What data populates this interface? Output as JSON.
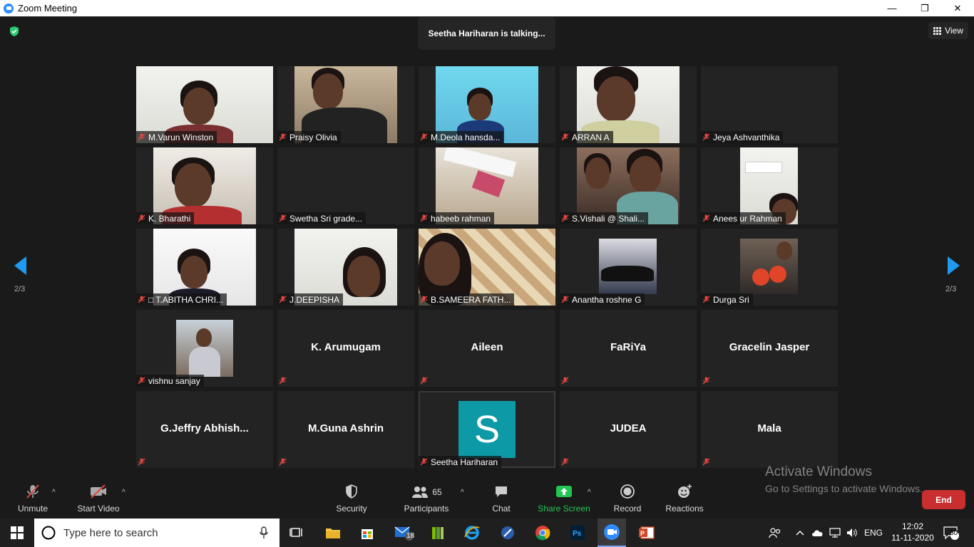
{
  "window": {
    "title": "Zoom Meeting",
    "minimize": "—",
    "restore": "❐",
    "close": "✕"
  },
  "banner": {
    "talking": "Seetha Hariharan is talking..."
  },
  "view": {
    "label": "View"
  },
  "pager": {
    "left": "2/3",
    "right": "2/3"
  },
  "participants_tiles": [
    "M.Varun Winston",
    "Praisy Olivia",
    "M.Deola hansda...",
    "ARRAN A",
    "Jeya Ashvanthika",
    "K. Bharathi",
    "Swetha Sri grade...",
    "habeeb rahman",
    "S.Vishali @ Shali...",
    "Anees ur Rahman",
    "□ T.ABITHA CHRI...",
    "J.DEEPISHA",
    "B.SAMEERA FATH...",
    "Anantha roshne G",
    "Durga Sri",
    "vishnu sanjay",
    "K. Arumugam",
    "Aileen",
    "FaRiYa",
    "Gracelin Jasper",
    "G.Jeffry Abhish...",
    "M.Guna Ashrin",
    "Seetha Hariharan",
    "JUDEA",
    "Mala"
  ],
  "avatar_letter": "S",
  "toolbar": {
    "unmute": "Unmute",
    "start_video": "Start Video",
    "security": "Security",
    "participants": "Participants",
    "participants_count": "65",
    "chat": "Chat",
    "share_screen": "Share Screen",
    "record": "Record",
    "reactions": "Reactions",
    "end": "End"
  },
  "watermark": {
    "line1": "Activate Windows",
    "line2": "Go to Settings to activate Windows."
  },
  "taskbar": {
    "search_placeholder": "Type here to search",
    "mail_badge": "18",
    "lang": "ENG",
    "time": "12:02",
    "date": "11-11-2020",
    "notif_count": "30"
  },
  "colors": {
    "accent": "#2D8CFF",
    "share_green": "#23C552",
    "end_red": "#C92F2F",
    "muted_red": "#E0473E"
  }
}
